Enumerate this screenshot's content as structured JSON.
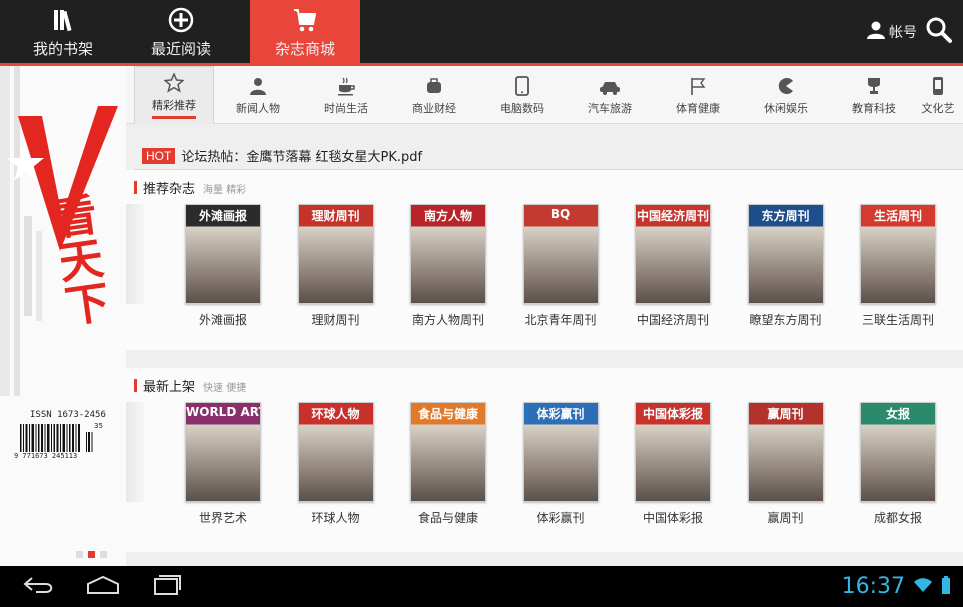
{
  "topbar": {
    "tabs": [
      {
        "label": "我的书架",
        "icon": "bookshelf-icon"
      },
      {
        "label": "最近阅读",
        "icon": "recent-read-icon"
      },
      {
        "label": "杂志商城",
        "icon": "cart-icon"
      }
    ],
    "active_tab": 2,
    "account_label": "帐号",
    "accent": "#e8463a"
  },
  "banner": {
    "logo_text": "看天下",
    "issn": "ISSN 1673-2456",
    "barcode_number": "9 771673 245113",
    "issue_mark": "35"
  },
  "categories": [
    {
      "label": "精彩推荐",
      "icon": "star-icon"
    },
    {
      "label": "新闻人物",
      "icon": "person-icon"
    },
    {
      "label": "时尚生活",
      "icon": "coffee-icon"
    },
    {
      "label": "商业财经",
      "icon": "briefcase-icon"
    },
    {
      "label": "电脑数码",
      "icon": "tablet-icon"
    },
    {
      "label": "汽车旅游",
      "icon": "car-icon"
    },
    {
      "label": "体育健康",
      "icon": "flag-icon"
    },
    {
      "label": "休闲娱乐",
      "icon": "pacman-icon"
    },
    {
      "label": "教育科技",
      "icon": "trophy-icon"
    },
    {
      "label": "文化艺",
      "icon": "phone-icon"
    }
  ],
  "hot": {
    "badge": "HOT",
    "text": "论坛热帖：金鹰节落幕 红毯女星大PK.pdf"
  },
  "recommended": {
    "title": "推荐杂志",
    "subtitle": "海量 精彩",
    "items": [
      {
        "name": "外滩画报",
        "cover_title": "外滩画报",
        "color": "#2b2b2b"
      },
      {
        "name": "理财周刊",
        "cover_title": "理财周刊",
        "color": "#c4322a"
      },
      {
        "name": "南方人物周刊",
        "cover_title": "南方人物",
        "color": "#b8242a"
      },
      {
        "name": "北京青年周刊",
        "cover_title": "BQ",
        "color": "#c23a30"
      },
      {
        "name": "中国经济周刊",
        "cover_title": "中国经济周刊",
        "color": "#c6352c"
      },
      {
        "name": "瞭望东方周刊",
        "cover_title": "东方周刊",
        "color": "#1f4e8c"
      },
      {
        "name": "三联生活周刊",
        "cover_title": "生活周刊",
        "color": "#d43a2e"
      }
    ]
  },
  "new_arrivals": {
    "title": "最新上架",
    "subtitle": "快速 便捷",
    "items": [
      {
        "name": "世界艺术",
        "cover_title": "WORLD ART",
        "color": "#8a2f6a"
      },
      {
        "name": "环球人物",
        "cover_title": "环球人物",
        "color": "#c8302c"
      },
      {
        "name": "食品与健康",
        "cover_title": "食品与健康",
        "color": "#e07a2a"
      },
      {
        "name": "体彩赢刊",
        "cover_title": "体彩赢刊",
        "color": "#2a6fb7"
      },
      {
        "name": "中国体彩报",
        "cover_title": "中国体彩报",
        "color": "#c7322b"
      },
      {
        "name": "赢周刊",
        "cover_title": "赢周刊",
        "color": "#b3322c"
      },
      {
        "name": "成都女报",
        "cover_title": "女报",
        "color": "#2a8b6c"
      }
    ]
  },
  "statusbar": {
    "time": "16:37",
    "status_color": "#33b5e5"
  }
}
